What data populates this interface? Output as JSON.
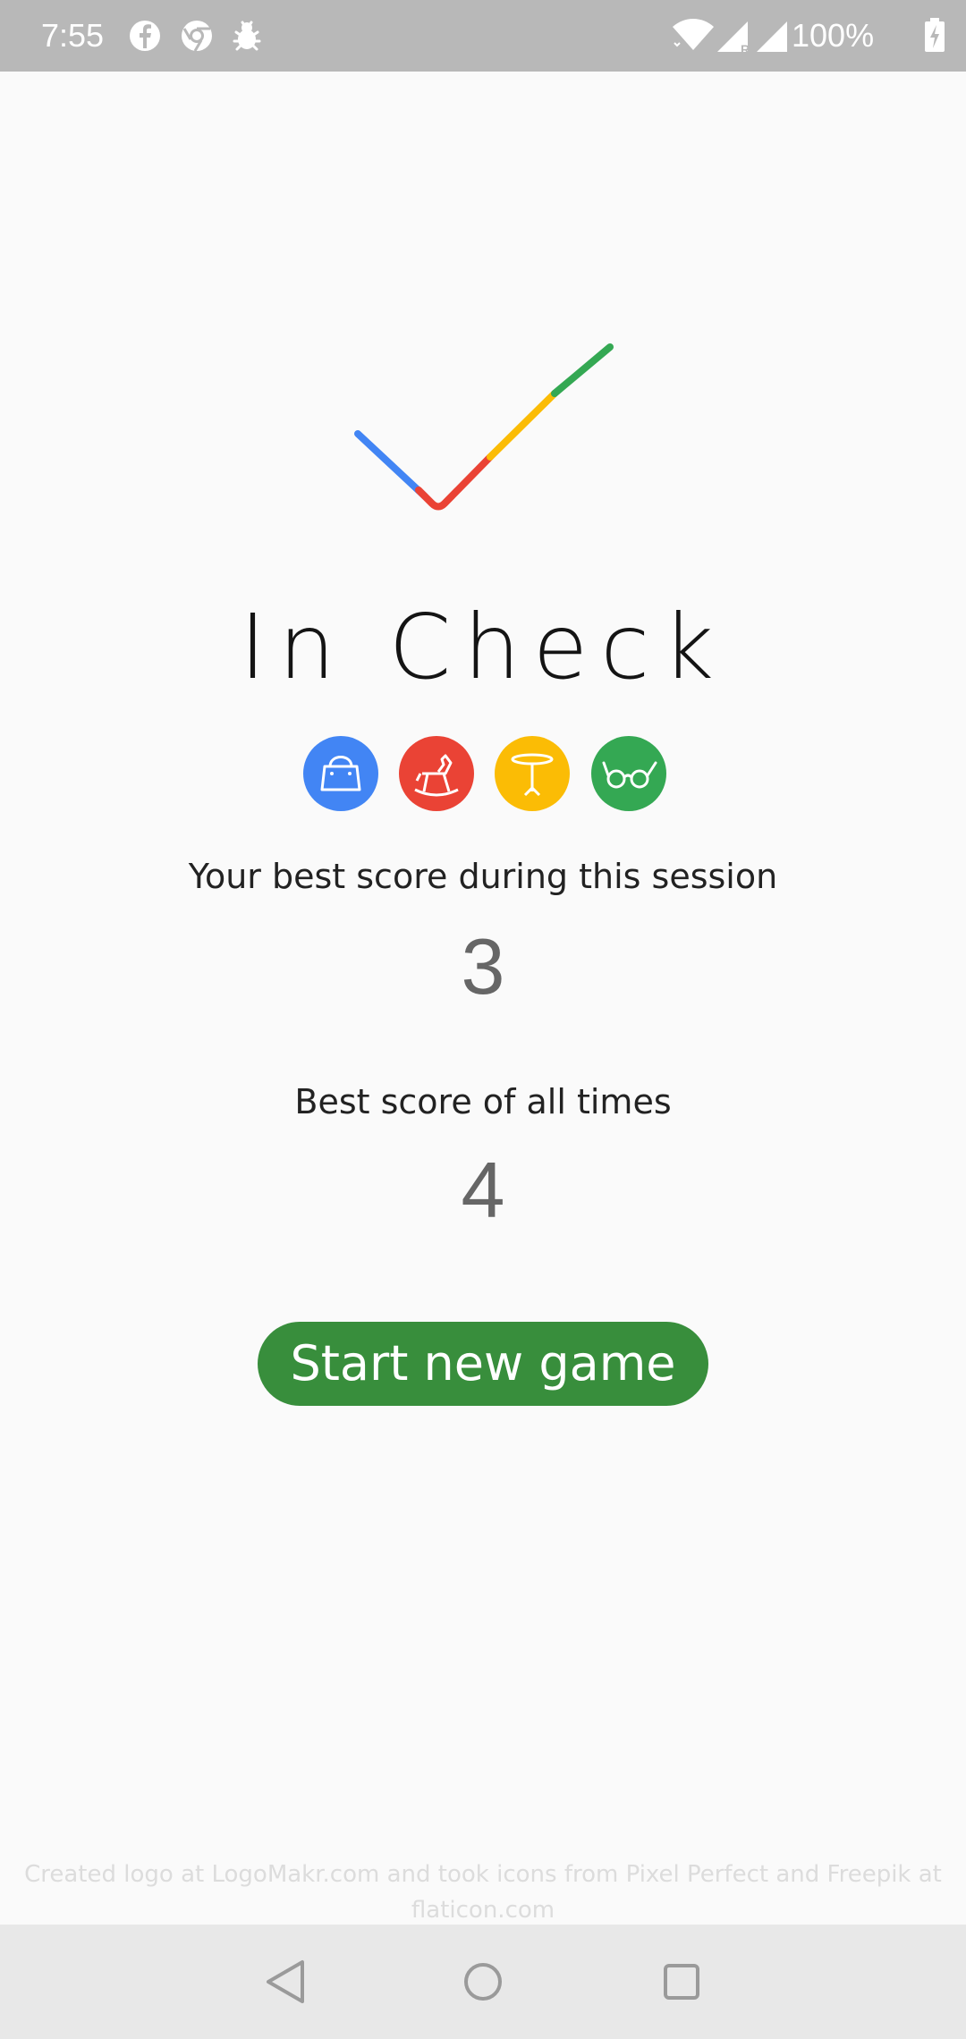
{
  "status_bar": {
    "time": "7:55",
    "battery": "100%",
    "icons_left": [
      "facebook-icon",
      "chrome-icon",
      "bug-icon"
    ],
    "icons_right": [
      "wifi-icon",
      "signal-r-icon",
      "signal-icon",
      "battery-charging-icon"
    ]
  },
  "app": {
    "title": "In Check",
    "logo_colors": [
      "#4285f4",
      "#ea4335",
      "#fbbc05",
      "#34a853"
    ],
    "category_icons": [
      {
        "name": "handbag-icon",
        "color": "#4285f4"
      },
      {
        "name": "rocking-horse-icon",
        "color": "#ea4335"
      },
      {
        "name": "table-icon",
        "color": "#fbbc05"
      },
      {
        "name": "glasses-icon",
        "color": "#34a853"
      }
    ]
  },
  "scores": {
    "session_label": "Your best score during this session",
    "session_value": "3",
    "alltime_label": "Best score of all times",
    "alltime_value": "4"
  },
  "actions": {
    "start_label": "Start new game"
  },
  "footer": {
    "credits_line1": "Created logo at LogoMakr.com and took icons from Pixel Perfect and Freepik at",
    "credits_line2": "flaticon.com"
  },
  "nav": [
    "back-icon",
    "home-icon",
    "recents-icon"
  ],
  "colors": {
    "button": "#388e3c",
    "status_bar": "#b8b8b8",
    "nav_bar": "#e8e8e8"
  }
}
